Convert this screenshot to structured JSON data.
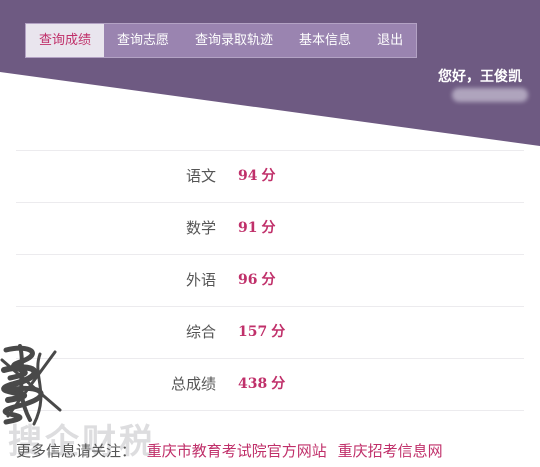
{
  "colors": {
    "banner": "#6e5a82",
    "nav_bg": "#9a84b0",
    "nav_active_bg": "#e9e5ee",
    "accent": "#c0306a"
  },
  "nav": {
    "items": [
      {
        "label": "查询成绩",
        "active": true
      },
      {
        "label": "查询志愿",
        "active": false
      },
      {
        "label": "查询录取轨迹",
        "active": false
      },
      {
        "label": "基本信息",
        "active": false
      },
      {
        "label": "退出",
        "active": false
      }
    ]
  },
  "greeting": "您好，王俊凯",
  "scores": {
    "unit": "分",
    "rows": [
      {
        "subject": "语文",
        "score": "94"
      },
      {
        "subject": "数学",
        "score": "91"
      },
      {
        "subject": "外语",
        "score": "96"
      },
      {
        "subject": "综合",
        "score": "157"
      },
      {
        "subject": "总成绩",
        "score": "438"
      }
    ]
  },
  "footer": {
    "lead": "更多信息请关注：",
    "links": [
      "重庆市教育考试院官方网站",
      "重庆招考信息网"
    ]
  },
  "watermark": "搜企财税"
}
